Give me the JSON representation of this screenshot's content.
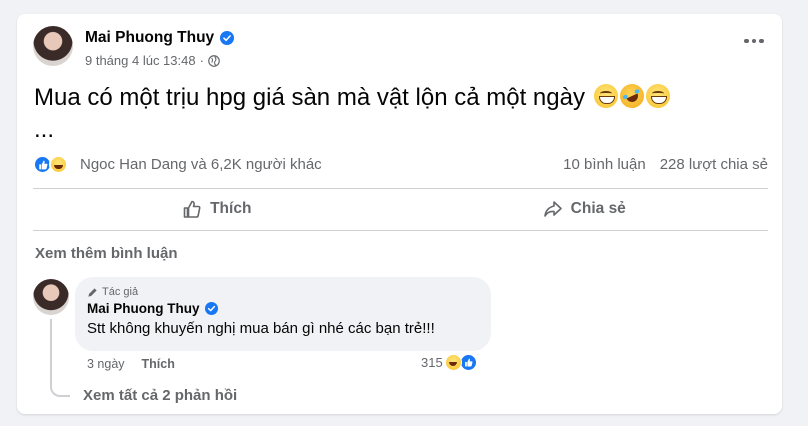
{
  "post": {
    "author": "Mai Phuong Thuy",
    "timestamp": "9 tháng 4 lúc 13:48",
    "audience_icon": "globe-icon",
    "text": "Mua có một trịu hpg giá sàn mà vật lộn cả một ngày",
    "text_suffix": "...",
    "emojis": [
      "grin-emoji",
      "rofl-emoji",
      "grin-emoji"
    ]
  },
  "reactions": {
    "icons": [
      "like-reaction",
      "haha-reaction"
    ],
    "summary": "Ngoc Han Dang và 6,2K người khác",
    "comments_count": "10 bình luận",
    "shares_count": "228 lượt chia sẻ"
  },
  "actions": {
    "like_label": "Thích",
    "share_label": "Chia sẻ"
  },
  "comments": {
    "see_more": "Xem thêm bình luận",
    "items": [
      {
        "author_tag": "Tác giả",
        "author": "Mai Phuong Thuy",
        "text": "Stt không khuyến nghị mua bán gì nhé các bạn trẻ!!!",
        "time": "3 ngày",
        "like_label": "Thích",
        "reaction_count": "315",
        "replies_label": "Xem tất cả 2 phản hồi"
      }
    ]
  },
  "colors": {
    "accent": "#1877f2",
    "muted_text": "#65676b",
    "background": "#f0f2f5"
  }
}
